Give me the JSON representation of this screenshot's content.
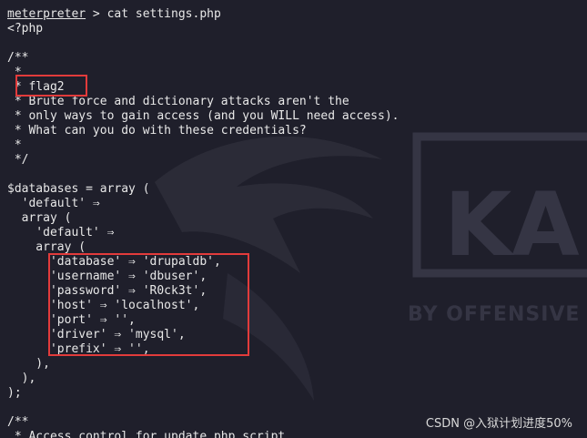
{
  "terminal": {
    "prompt_user": "meterpreter",
    "prompt_rest": " > cat settings.php",
    "lines": [
      "<?php",
      "",
      "/**",
      " *",
      " * flag2",
      " * Brute force and dictionary attacks aren't the",
      " * only ways to gain access (and you WILL need access).",
      " * What can you do with these credentials?",
      " *",
      " */",
      "",
      "$databases = array (",
      "  'default' ⇒",
      "  array (",
      "    'default' ⇒",
      "    array (",
      "      'database' ⇒ 'drupaldb',",
      "      'username' ⇒ 'dbuser',",
      "      'password' ⇒ 'R0ck3t',",
      "      'host' ⇒ 'localhost',",
      "      'port' ⇒ '',",
      "      'driver' ⇒ 'mysql',",
      "      'prefix' ⇒ '',",
      "    ),",
      "  ),",
      ");",
      "",
      "/**",
      " * Access control for update.php script"
    ]
  },
  "watermark": {
    "logo_text": "KA",
    "tagline": "BY OFFENSIVE"
  },
  "footer": {
    "csdn_text": "CSDN @入狱计划进度50%"
  },
  "colors": {
    "background": "#1f1f2b",
    "text": "#e8e8e8",
    "highlight_box": "#e23b3b"
  }
}
